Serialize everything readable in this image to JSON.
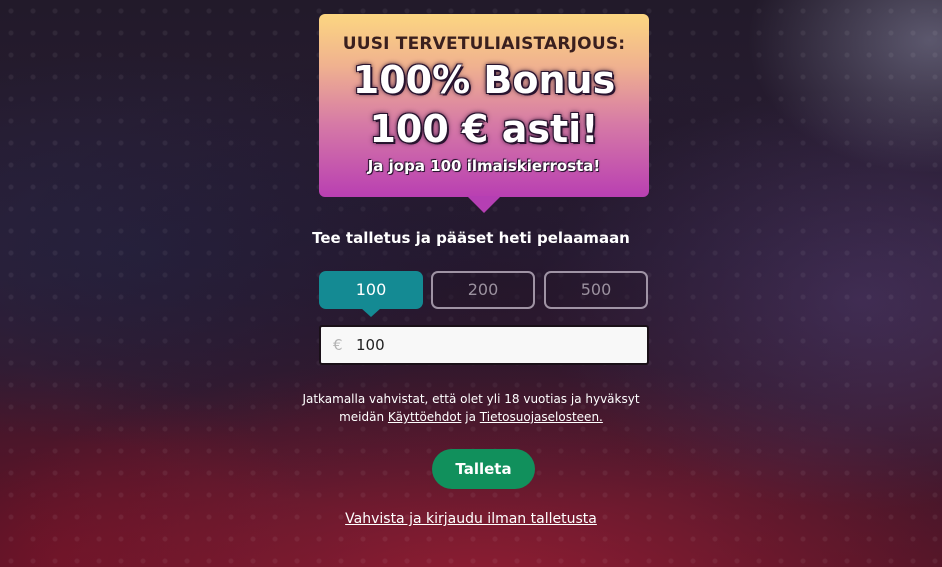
{
  "promo": {
    "kicker": "UUSI TERVETULIAISTARJOUS:",
    "headline_line1": "100% Bonus",
    "headline_line2": "100 € asti!",
    "subline": "Ja jopa 100 ilmaiskierrosta!"
  },
  "deposit": {
    "tagline": "Tee talletus ja pääset heti pelaamaan",
    "amount_options": [
      "100",
      "200",
      "500"
    ],
    "selected_amount": "100",
    "currency_symbol": "€",
    "amount_value": "100"
  },
  "terms": {
    "text_before": "Jatkamalla vahvistat, että olet yli 18 vuotias ja hyväksyt",
    "text_middle": "meidän",
    "terms_link": "Käyttöehdot",
    "conjunction": "ja",
    "privacy_link": "Tietosuojaselosteen."
  },
  "actions": {
    "deposit_button": "Talleta",
    "login_without_deposit": "Vahvista ja kirjaudu ilman talletusta"
  },
  "colors": {
    "selected_amount": "#148a93",
    "deposit_button": "#11905c",
    "promo_gradient_top": "#fcd681",
    "promo_gradient_bottom": "#b93fb2"
  }
}
